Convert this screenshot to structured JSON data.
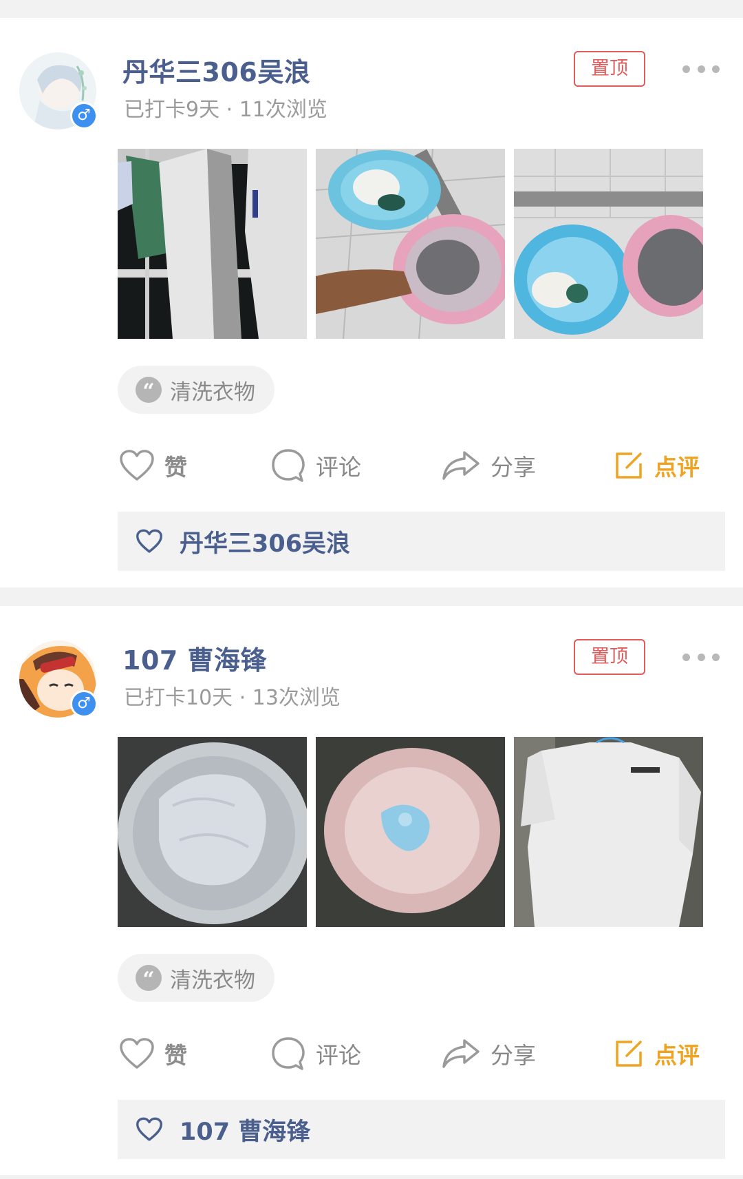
{
  "posts": [
    {
      "username": "丹华三306吴浪",
      "meta": "已打卡9天 · 11次浏览",
      "pin_label": "置顶",
      "gender_symbol": "♂",
      "topic": "清洗衣物",
      "actions": {
        "like": "赞",
        "comment": "评论",
        "share": "分享",
        "review": "点评"
      },
      "likers": "丹华三306吴浪"
    },
    {
      "username": "107 曹海锋",
      "meta": "已打卡10天 · 13次浏览",
      "pin_label": "置顶",
      "gender_symbol": "♂",
      "topic": "清洗衣物",
      "actions": {
        "like": "赞",
        "comment": "评论",
        "share": "分享",
        "review": "点评"
      },
      "likers": "107 曹海锋"
    }
  ],
  "colors": {
    "username": "#4a5f8d",
    "pin": "#e25a5a",
    "review": "#f0a320",
    "muted": "#888888",
    "gender_badge": "#3d8ff0"
  },
  "icons": [
    "heart-outline-icon",
    "comment-bubble-icon",
    "share-arrow-icon",
    "edit-note-icon",
    "quote-icon",
    "more-dots-icon",
    "male-icon"
  ]
}
